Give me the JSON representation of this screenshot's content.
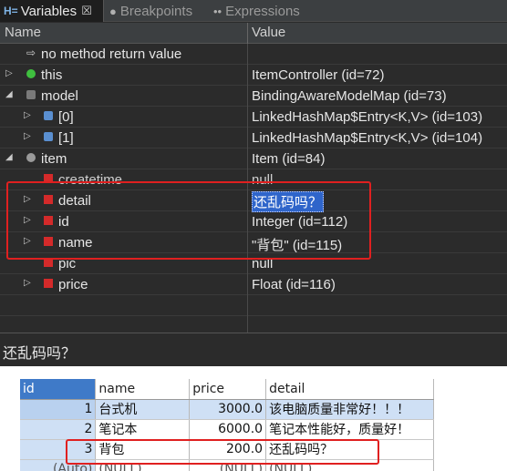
{
  "tabs": [
    {
      "icon": "variables-icon",
      "label": "Variables",
      "close": "☒",
      "active": true
    },
    {
      "icon": "breakpoints-icon",
      "label": "Breakpoints",
      "active": false
    },
    {
      "icon": "expressions-icon",
      "label": "Expressions",
      "active": false
    }
  ],
  "columns": {
    "name": "Name",
    "value": "Value"
  },
  "variables": [
    {
      "name": "no method return value",
      "value": ""
    },
    {
      "name": "this",
      "value": "ItemController  (id=72)"
    },
    {
      "name": "model",
      "value": "BindingAwareModelMap  (id=73)"
    },
    {
      "name": "[0]",
      "value": "LinkedHashMap$Entry<K,V>  (id=103)"
    },
    {
      "name": "[1]",
      "value": "LinkedHashMap$Entry<K,V>  (id=104)"
    },
    {
      "name": "item",
      "value": "Item  (id=84)"
    },
    {
      "name": "createtime",
      "value": "null"
    },
    {
      "name": "detail",
      "value": "还乱码吗？"
    },
    {
      "name": "id",
      "value": "Integer  (id=112)"
    },
    {
      "name": "name",
      "value": "\"背包\" (id=115)"
    },
    {
      "name": "pic",
      "value": "null"
    },
    {
      "name": "price",
      "value": "Float  (id=116)"
    }
  ],
  "detail_text": "还乱码吗？",
  "sql_table": {
    "headers": [
      "id",
      "name",
      "price",
      "detail"
    ],
    "rows": [
      [
        "1",
        "台式机",
        "3000.0",
        "该电脑质量非常好！！！"
      ],
      [
        "2",
        "笔记本",
        "6000.0",
        "笔记本性能好，质量好！"
      ],
      [
        "3",
        "背包",
        "200.0",
        "还乱码吗？"
      ],
      [
        "(Auto)",
        "(NULL)",
        "(NULL)",
        "(NULL)"
      ]
    ]
  }
}
